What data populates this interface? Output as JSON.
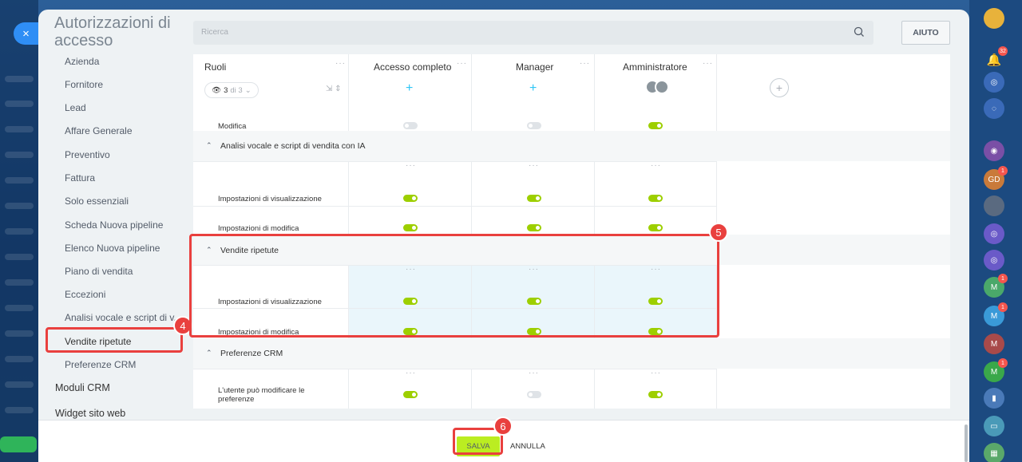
{
  "window": {
    "close_label": "×"
  },
  "title": "Autorizzazioni di accesso",
  "nav": {
    "items": [
      "Azienda",
      "Fornitore",
      "Lead",
      "Affare Generale",
      "Preventivo",
      "Fattura",
      "Solo essenziali",
      "Scheda Nuova pipeline",
      "Elenco Nuova pipeline",
      "Piano di vendita",
      "Eccezioni",
      "Analisi vocale e script di v...",
      "Vendite ripetute",
      "Preferenze CRM"
    ],
    "top_items": [
      "Moduli CRM",
      "Widget sito web"
    ]
  },
  "search": {
    "placeholder": "Ricerca"
  },
  "help_label": "AIUTO",
  "table": {
    "roles_header": "Ruoli",
    "role_filter": {
      "count": "3",
      "of": "di 3"
    },
    "columns": [
      "Accesso completo",
      "Manager",
      "Amministratore"
    ],
    "dots": "···",
    "sections": [
      {
        "label": "Analisi vocale e script di vendita con IA"
      },
      {
        "label": "Vendite ripetute"
      },
      {
        "label": "Preferenze CRM"
      }
    ],
    "rows": {
      "modifica": "Modifica",
      "view_settings": "Impostazioni di visualizzazione",
      "edit_settings": "Impostazioni di modifica",
      "crm_pref_line1": "L'utente può modificare le",
      "crm_pref_line2": "preferenze"
    },
    "toggle_states": {
      "modifica": [
        false,
        false,
        true
      ],
      "ai_view": [
        true,
        true,
        true
      ],
      "ai_edit": [
        true,
        true,
        true
      ],
      "rep_view": [
        true,
        true,
        true
      ],
      "rep_edit": [
        true,
        true,
        true
      ],
      "crm_pref": [
        true,
        false,
        true
      ]
    }
  },
  "footer": {
    "save": "SALVA",
    "cancel": "ANNULLA"
  },
  "annotations": {
    "b4": "4",
    "b5": "5",
    "b6": "6"
  },
  "rightbar": {
    "badges": [
      "32",
      "1",
      "1",
      "1",
      "1"
    ],
    "initials": [
      "GD",
      "M",
      "M",
      "M",
      "M"
    ]
  },
  "colors": {
    "toggle_on": "#9dcf00",
    "accent": "#2fc6f6",
    "save": "#bbed21",
    "annotation": "#e9403e"
  }
}
